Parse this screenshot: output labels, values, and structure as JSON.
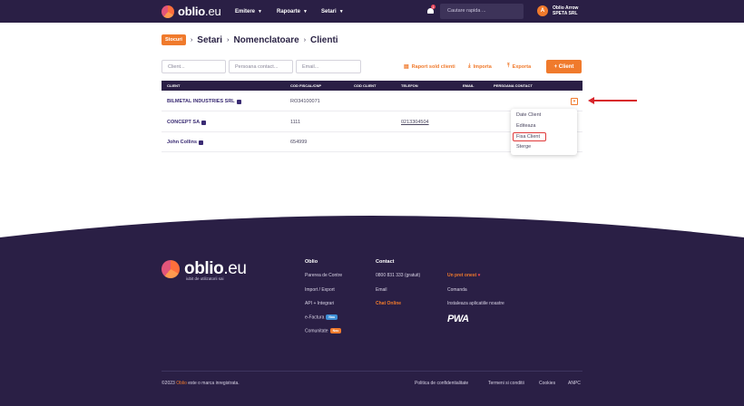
{
  "header": {
    "logo_brand": "oblio",
    "logo_tld": ".eu",
    "nav": [
      {
        "label": "Emitere"
      },
      {
        "label": "Rapoarte"
      },
      {
        "label": "Setari"
      }
    ],
    "notification_count": "1",
    "search_placeholder": "Cautare rapida ...",
    "user_initial": "A",
    "user_name": "Oblio Arrow",
    "user_company": "SPETA SRL"
  },
  "breadcrumb": {
    "badge": "Stocuri",
    "items": [
      "Setari",
      "Nomenclatoare",
      "Clienti"
    ]
  },
  "filters": {
    "client_placeholder": "Client...",
    "contact_placeholder": "Persoana contact...",
    "email_placeholder": "Email..."
  },
  "actions": {
    "report": "Raport sold clienti",
    "import": "Importa",
    "export": "Exporta",
    "add": "+ Client"
  },
  "table": {
    "columns": [
      "CLIENT",
      "COD FISCAL/CNP",
      "COD CLIENT",
      "TELEFON",
      "EMAIL",
      "PERSOANA CONTACT"
    ],
    "rows": [
      {
        "client": "BILMETAL INDUSTRIES SRL",
        "cod_fiscal": "RO34100071",
        "cod_client": "",
        "telefon": "",
        "email": "",
        "contact": ""
      },
      {
        "client": "CONCEPT SA",
        "cod_fiscal": "1111",
        "cod_client": "",
        "telefon": "0213304504",
        "email": "",
        "contact": ""
      },
      {
        "client": "John Collins",
        "cod_fiscal": "654999",
        "cod_client": "",
        "telefon": "",
        "email": "",
        "contact": ""
      }
    ]
  },
  "dropdown": {
    "items": [
      "Date Client",
      "Editeaza",
      "Fisa Client",
      "Sterge"
    ],
    "highlighted": "Fisa Client"
  },
  "footer": {
    "tagline": "iubit de utilizatorii sai",
    "col1_title": "Oblio",
    "col1_links": [
      "Parerea de Contre",
      "Import / Export",
      "API + Integrari",
      "e-Factura",
      "Comunitate"
    ],
    "efactura_badge": "Nou",
    "comunitate_badge": "Nou",
    "col2_title": "Contact",
    "col2_links": [
      "0800 831 333 (gratuit)",
      "Email",
      "Chat Online"
    ],
    "col3_links": [
      "Un pret onest",
      "Comanda",
      "Instaleaza aplicatiile noastre"
    ],
    "pwa": "PWA",
    "copyright_year": "©2023",
    "copyright_brand": "Oblio",
    "copyright_rest": "este o marca inregistrata.",
    "bottom_links": [
      "Politica de confidentialitate",
      "Termeni si conditii",
      "Cookies",
      "ANPC"
    ]
  },
  "colors": {
    "navy": "#2a1f45",
    "accent": "#f07a2c",
    "annotation_red": "#d8242b"
  }
}
